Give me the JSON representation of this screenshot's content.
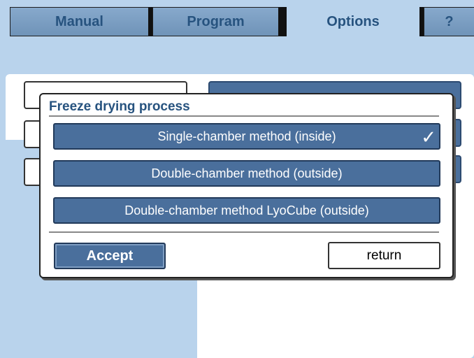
{
  "tabs": [
    {
      "label": "Manual",
      "active": false
    },
    {
      "label": "Program",
      "active": false
    },
    {
      "label": "Options",
      "active": true
    },
    {
      "label": "?",
      "active": false
    }
  ],
  "dialog": {
    "title": "Freeze drying process",
    "options": [
      {
        "label": "Single-chamber method (inside)",
        "selected": true
      },
      {
        "label": "Double-chamber method (outside)",
        "selected": false
      },
      {
        "label": "Double-chamber method LyoCube (outside)",
        "selected": false
      }
    ],
    "accept_label": "Accept",
    "return_label": "return",
    "check_glyph": "✓"
  },
  "colors": {
    "background": "#b9d3ec",
    "button": "#4a6f9c",
    "title_text": "#27537f"
  }
}
